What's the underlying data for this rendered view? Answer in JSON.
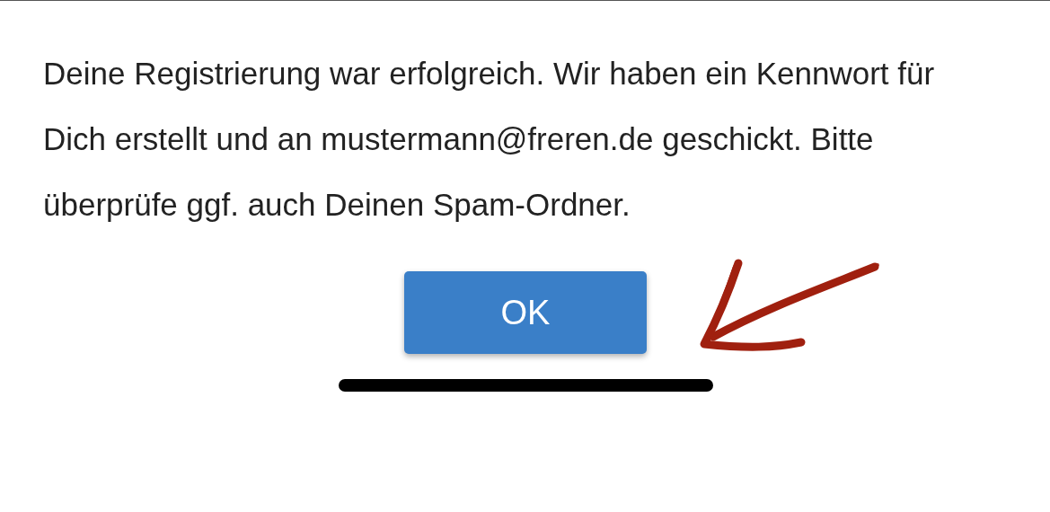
{
  "message": "Deine Registrierung war erfolgreich. Wir haben ein Kennwort für Dich erstellt und an mustermann@freren.de geschickt. Bitte überprüfe ggf. auch Deinen Spam-Ordner.",
  "button": "OK"
}
